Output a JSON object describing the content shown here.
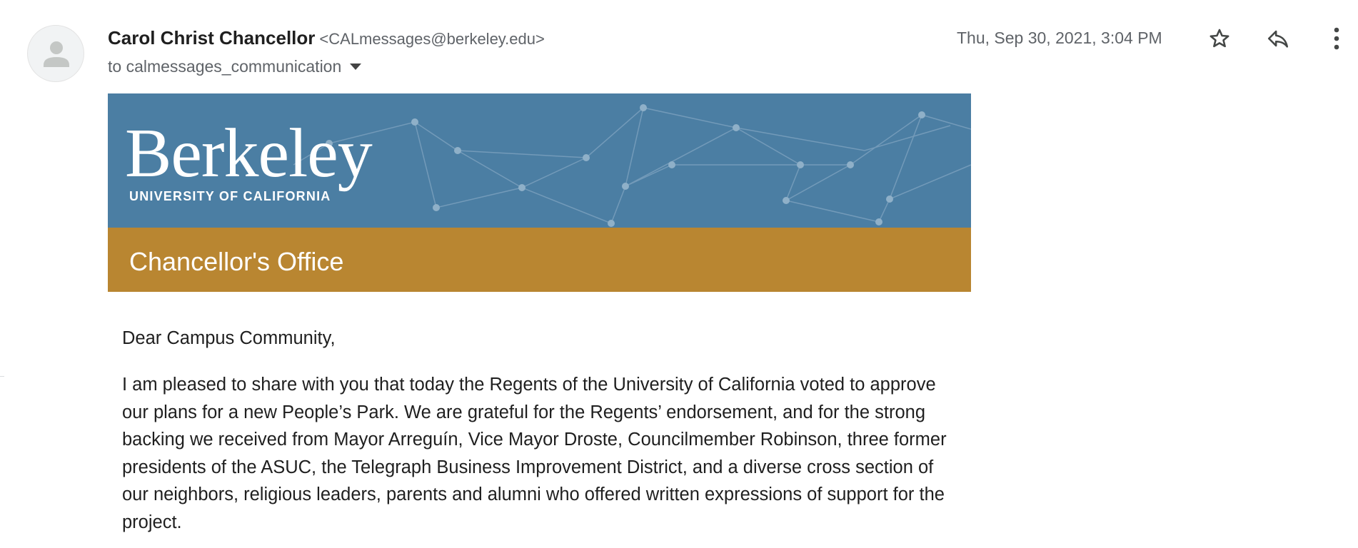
{
  "sender": {
    "name": "Carol Christ Chancellor",
    "email": "<CALmessages@berkeley.edu>"
  },
  "recipients": {
    "label": "to calmessages_communication"
  },
  "date": "Thu, Sep 30, 2021, 3:04 PM",
  "icons": {
    "avatar": "default-person-avatar",
    "star": "star-icon",
    "reply": "reply-icon",
    "more": "more-vert-icon",
    "dropdown": "chevron-down-icon"
  },
  "banner": {
    "logo_word": "Berkeley",
    "logo_sub": "UNIVERSITY OF CALIFORNIA",
    "office_title": "Chancellor's Office",
    "colors": {
      "banner_blue": "#4b7ea3",
      "office_gold": "#b98631"
    }
  },
  "message": {
    "greeting": "Dear Campus Community,",
    "paragraph1": "I am pleased to share with you that today the Regents of the University of California voted to approve our plans for a new People’s Park. We are grateful for the Regents’ endorsement, and for the strong backing we received from Mayor Arreguín, Vice Mayor Droste, Councilmember Robinson, three former presidents of the ASUC, the Telegraph Business Improvement District, and a diverse cross section of our neighbors, religious leaders, parents and alumni who offered written expressions of support for the project."
  }
}
